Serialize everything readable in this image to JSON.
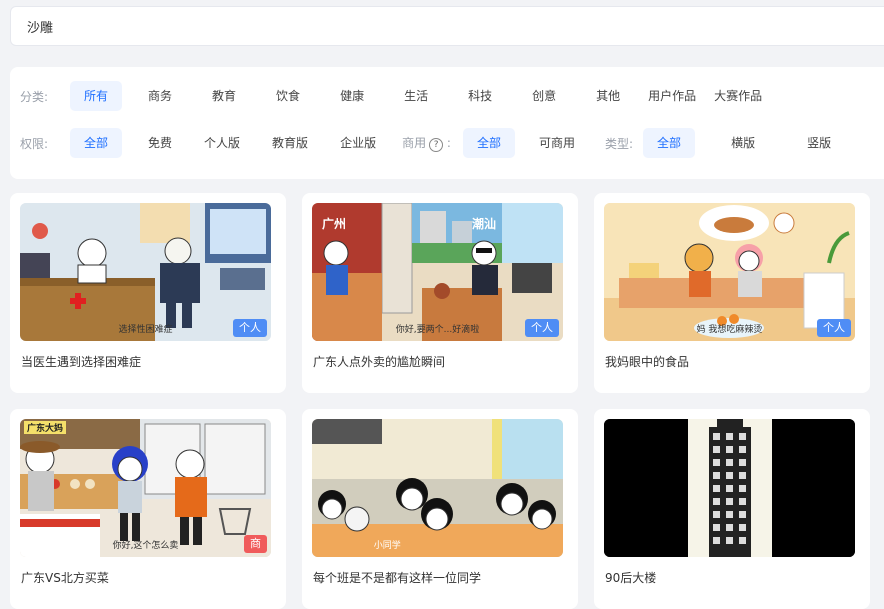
{
  "search": {
    "value": "沙雕"
  },
  "filters": {
    "category_label": "分类:",
    "categories": [
      "所有",
      "商务",
      "教育",
      "饮食",
      "健康",
      "生活",
      "科技",
      "创意",
      "其他",
      "用户作品",
      "大赛作品"
    ],
    "permission_label": "权限:",
    "permissions": [
      "全部",
      "免费",
      "个人版",
      "教育版",
      "企业版"
    ],
    "commercial_label": "商用",
    "commercial_help_icon": "?",
    "commercial_colon": ":",
    "commercial_options": [
      "全部",
      "可商用"
    ],
    "type_label": "类型:",
    "types": [
      "全部",
      "横版",
      "竖版"
    ]
  },
  "cards": [
    {
      "title": "当医生遇到选择困难症",
      "badge": "个人",
      "caption": "选择性困难症",
      "icon": "doctor-scene-thumbnail"
    },
    {
      "title": "广东人点外卖的尴尬瞬间",
      "badge": "个人",
      "caption": "你好,要两个...好滴啦",
      "tag_left": "广州",
      "tag_right": "潮汕",
      "icon": "living-room-thumbnail"
    },
    {
      "title": "我妈眼中的食品",
      "badge": "个人",
      "caption": "妈 我想吃麻辣烫",
      "icon": "mom-food-thumbnail"
    },
    {
      "title": "广东VS北方买菜",
      "badge": "商",
      "caption": "你好,这个怎么卖",
      "tag_left": "广东大妈",
      "icon": "market-thumbnail"
    },
    {
      "title": "每个班是不是都有这样一位同学",
      "caption": "小同学",
      "icon": "classroom-thumbnail"
    },
    {
      "title": "90后大楼",
      "icon": "building-thumbnail"
    }
  ]
}
